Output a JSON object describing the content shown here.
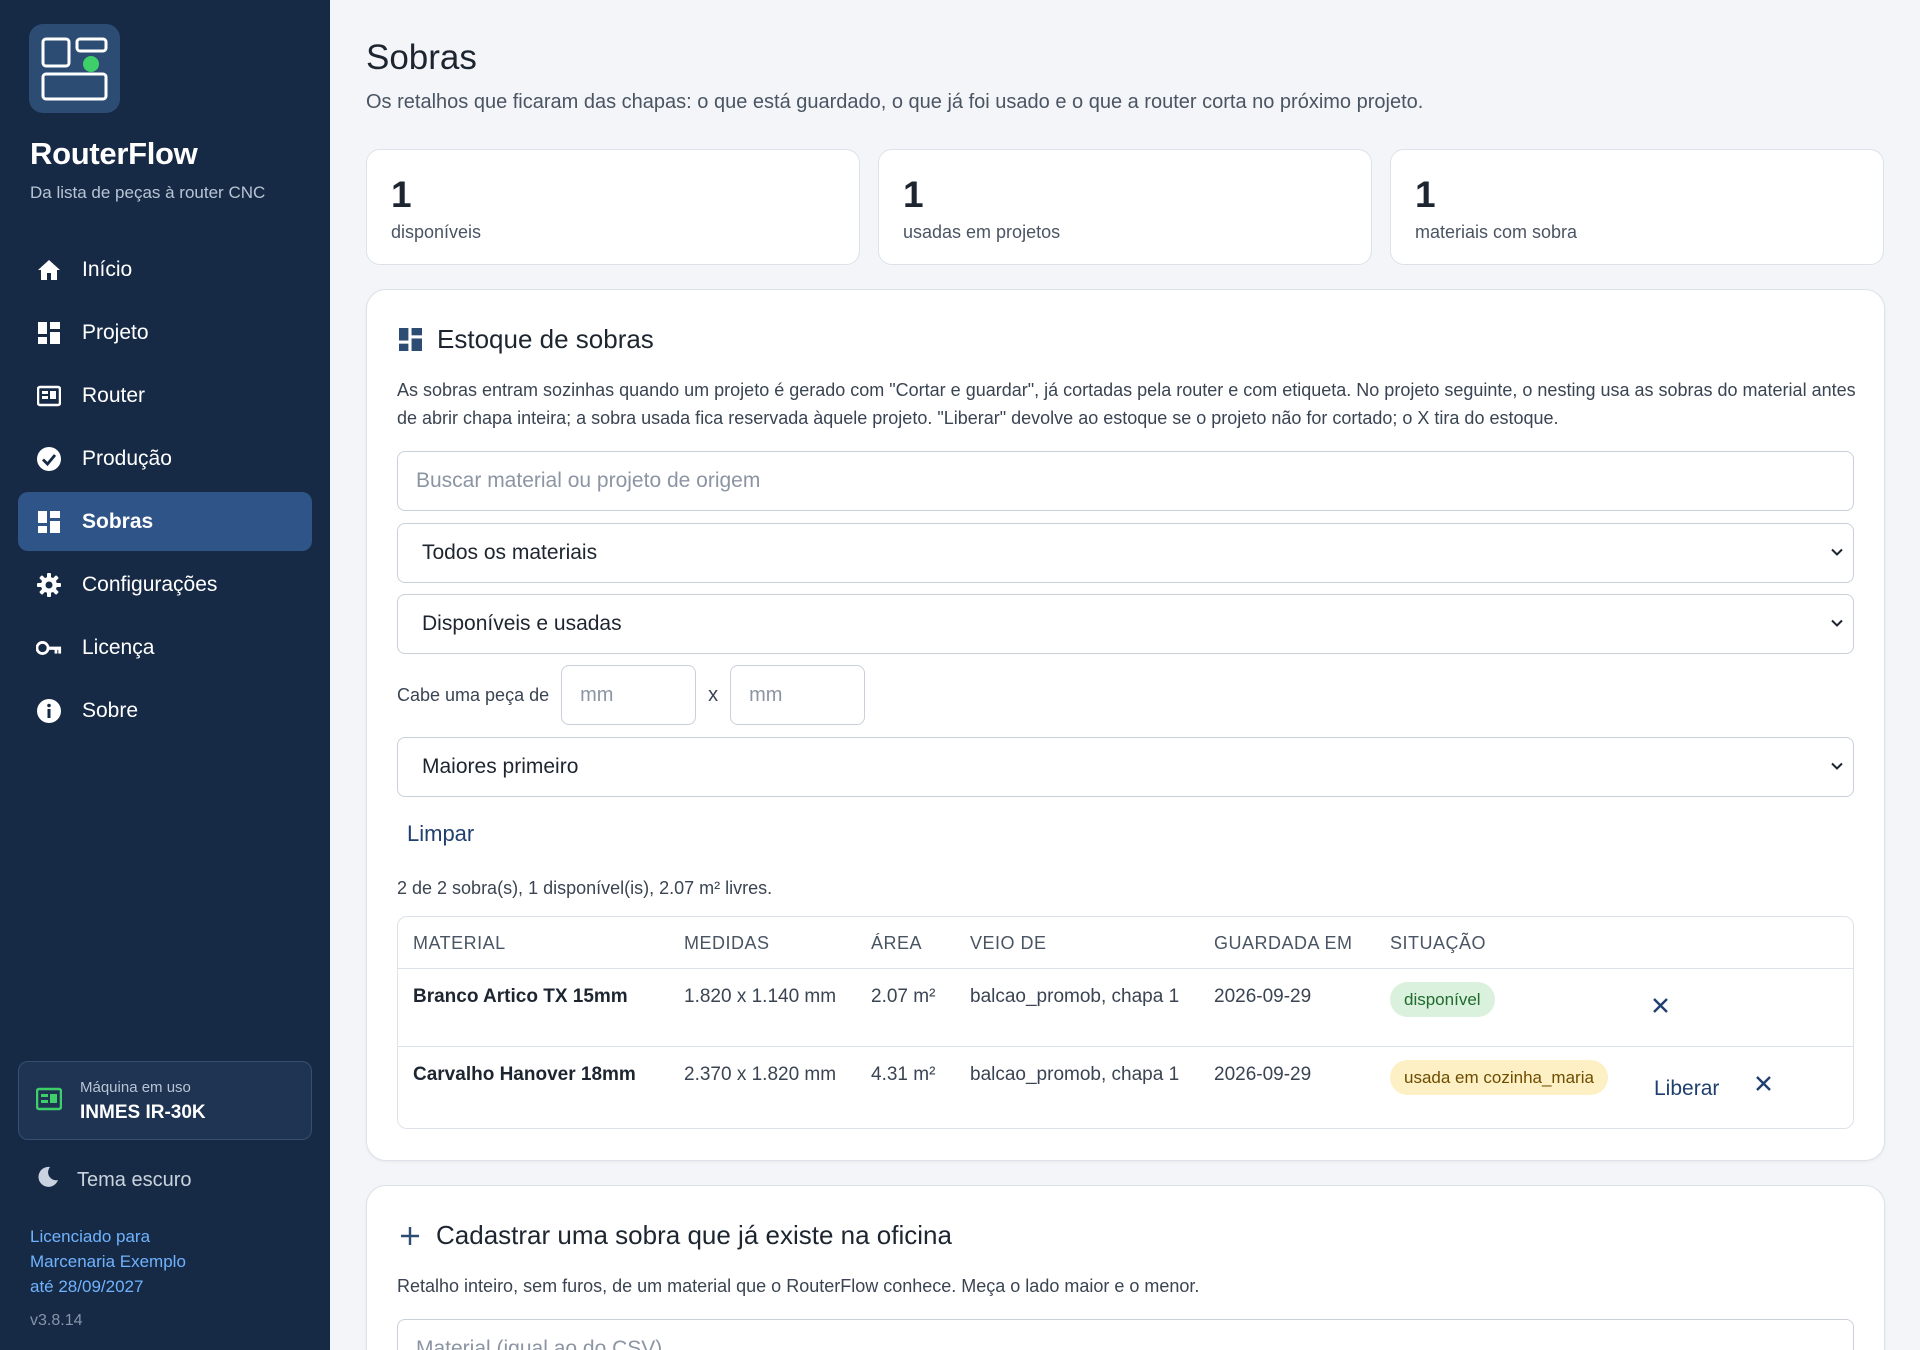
{
  "app": {
    "name": "RouterFlow",
    "tagline": "Da lista de peças à router CNC"
  },
  "sidebar": {
    "items": [
      {
        "label": "Início",
        "icon": "home-icon"
      },
      {
        "label": "Projeto",
        "icon": "grid-icon"
      },
      {
        "label": "Router",
        "icon": "router-icon"
      },
      {
        "label": "Produção",
        "icon": "check-circle-icon"
      },
      {
        "label": "Sobras",
        "icon": "grid-icon",
        "active": true
      },
      {
        "label": "Configurações",
        "icon": "gear-icon"
      },
      {
        "label": "Licença",
        "icon": "key-icon"
      },
      {
        "label": "Sobre",
        "icon": "info-icon"
      }
    ],
    "machine": {
      "label": "Máquina em uso",
      "name": "INMES IR-30K"
    },
    "theme_label": "Tema escuro",
    "license_lines": [
      "Licenciado para",
      "Marcenaria Exemplo",
      "até 28/09/2027"
    ],
    "version": "v3.8.14"
  },
  "page": {
    "title": "Sobras",
    "subtitle": "Os retalhos que ficaram das chapas: o que está guardado, o que já foi usado e o que a router corta no próximo projeto."
  },
  "stats": [
    {
      "value": "1",
      "label": "disponíveis"
    },
    {
      "value": "1",
      "label": "usadas em projetos"
    },
    {
      "value": "1",
      "label": "materiais com sobra"
    }
  ],
  "stock": {
    "title": "Estoque de sobras",
    "description": "As sobras entram sozinhas quando um projeto é gerado com \"Cortar e guardar\", já cortadas pela router e com etiqueta. No projeto seguinte, o nesting usa as sobras do material antes de abrir chapa inteira; a sobra usada fica reservada àquele projeto. \"Liberar\" devolve ao estoque se o projeto não for cortado; o X tira do estoque.",
    "search_placeholder": "Buscar material ou projeto de origem",
    "material_filter": "Todos os materiais",
    "status_filter": "Disponíveis e usadas",
    "fit_label": "Cabe uma peça de",
    "mm_placeholder": "mm",
    "times": "x",
    "sort": "Maiores primeiro",
    "clear_label": "Limpar",
    "summary": "2 de 2 sobra(s), 1 disponível(is), 2.07 m² livres.",
    "columns": [
      "MATERIAL",
      "MEDIDAS",
      "ÁREA",
      "VEIO DE",
      "GUARDADA EM",
      "SITUAÇÃO"
    ],
    "rows": [
      {
        "material": "Branco Artico TX 15mm",
        "size": "1.820 x 1.140 mm",
        "area": "2.07 m²",
        "origin": "balcao_promob, chapa 1",
        "stored": "2026-09-29",
        "status": "disponível",
        "status_kind": "ok"
      },
      {
        "material": "Carvalho Hanover 18mm",
        "size": "2.370 x 1.820 mm",
        "area": "4.31 m²",
        "origin": "balcao_promob, chapa 1",
        "stored": "2026-09-29",
        "status": "usada em cozinha_maria",
        "status_kind": "used",
        "action": "Liberar"
      }
    ]
  },
  "register": {
    "title": "Cadastrar uma sobra que já existe na oficina",
    "description": "Retalho inteiro, sem furos, de um material que o RouterFlow conhece. Meça o lado maior e o menor.",
    "material_placeholder": "Material (igual ao do CSV)"
  },
  "colors": {
    "sidebar_bg": "#172a45",
    "active_item": "#2f5487",
    "accent": "#1f3f6e",
    "badge_ok": "#d9f1dd",
    "badge_used": "#fdf0c4",
    "machine_icon": "#3ecf6b"
  }
}
